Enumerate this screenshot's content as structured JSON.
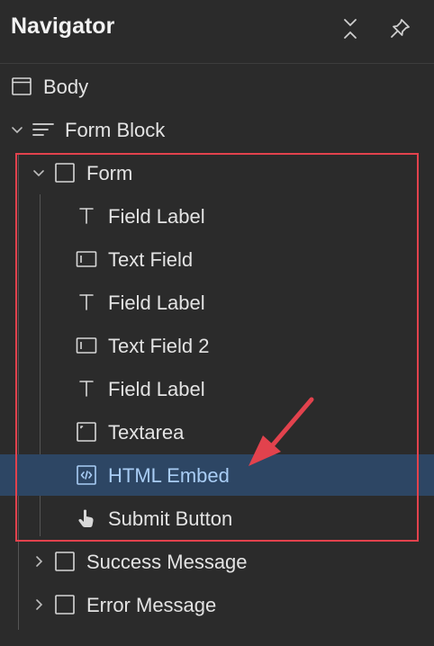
{
  "header": {
    "title": "Navigator",
    "collapse_icon": "collapse-all-icon",
    "pin_icon": "pin-icon"
  },
  "tree": {
    "body": {
      "label": "Body",
      "icon": "body-icon"
    },
    "form_block": {
      "label": "Form Block",
      "icon": "form-block-icon"
    },
    "form": {
      "label": "Form",
      "icon": "form-icon"
    },
    "children": [
      {
        "label": "Field Label",
        "icon": "text-icon"
      },
      {
        "label": "Text Field",
        "icon": "text-field-icon"
      },
      {
        "label": "Field Label",
        "icon": "text-icon"
      },
      {
        "label": "Text Field 2",
        "icon": "text-field-icon"
      },
      {
        "label": "Field Label",
        "icon": "text-icon"
      },
      {
        "label": "Textarea",
        "icon": "textarea-icon"
      },
      {
        "label": "HTML Embed",
        "icon": "code-embed-icon",
        "selected": true
      },
      {
        "label": "Submit Button",
        "icon": "pointer-hand-icon"
      }
    ],
    "success_message": {
      "label": "Success Message",
      "icon": "div-icon"
    },
    "error_message": {
      "label": "Error Message",
      "icon": "div-icon"
    }
  },
  "colors": {
    "background": "#2b2b2b",
    "selected_row": "#2d4664",
    "selected_text": "#a9cdf5",
    "annotation_red": "#e2424d"
  }
}
